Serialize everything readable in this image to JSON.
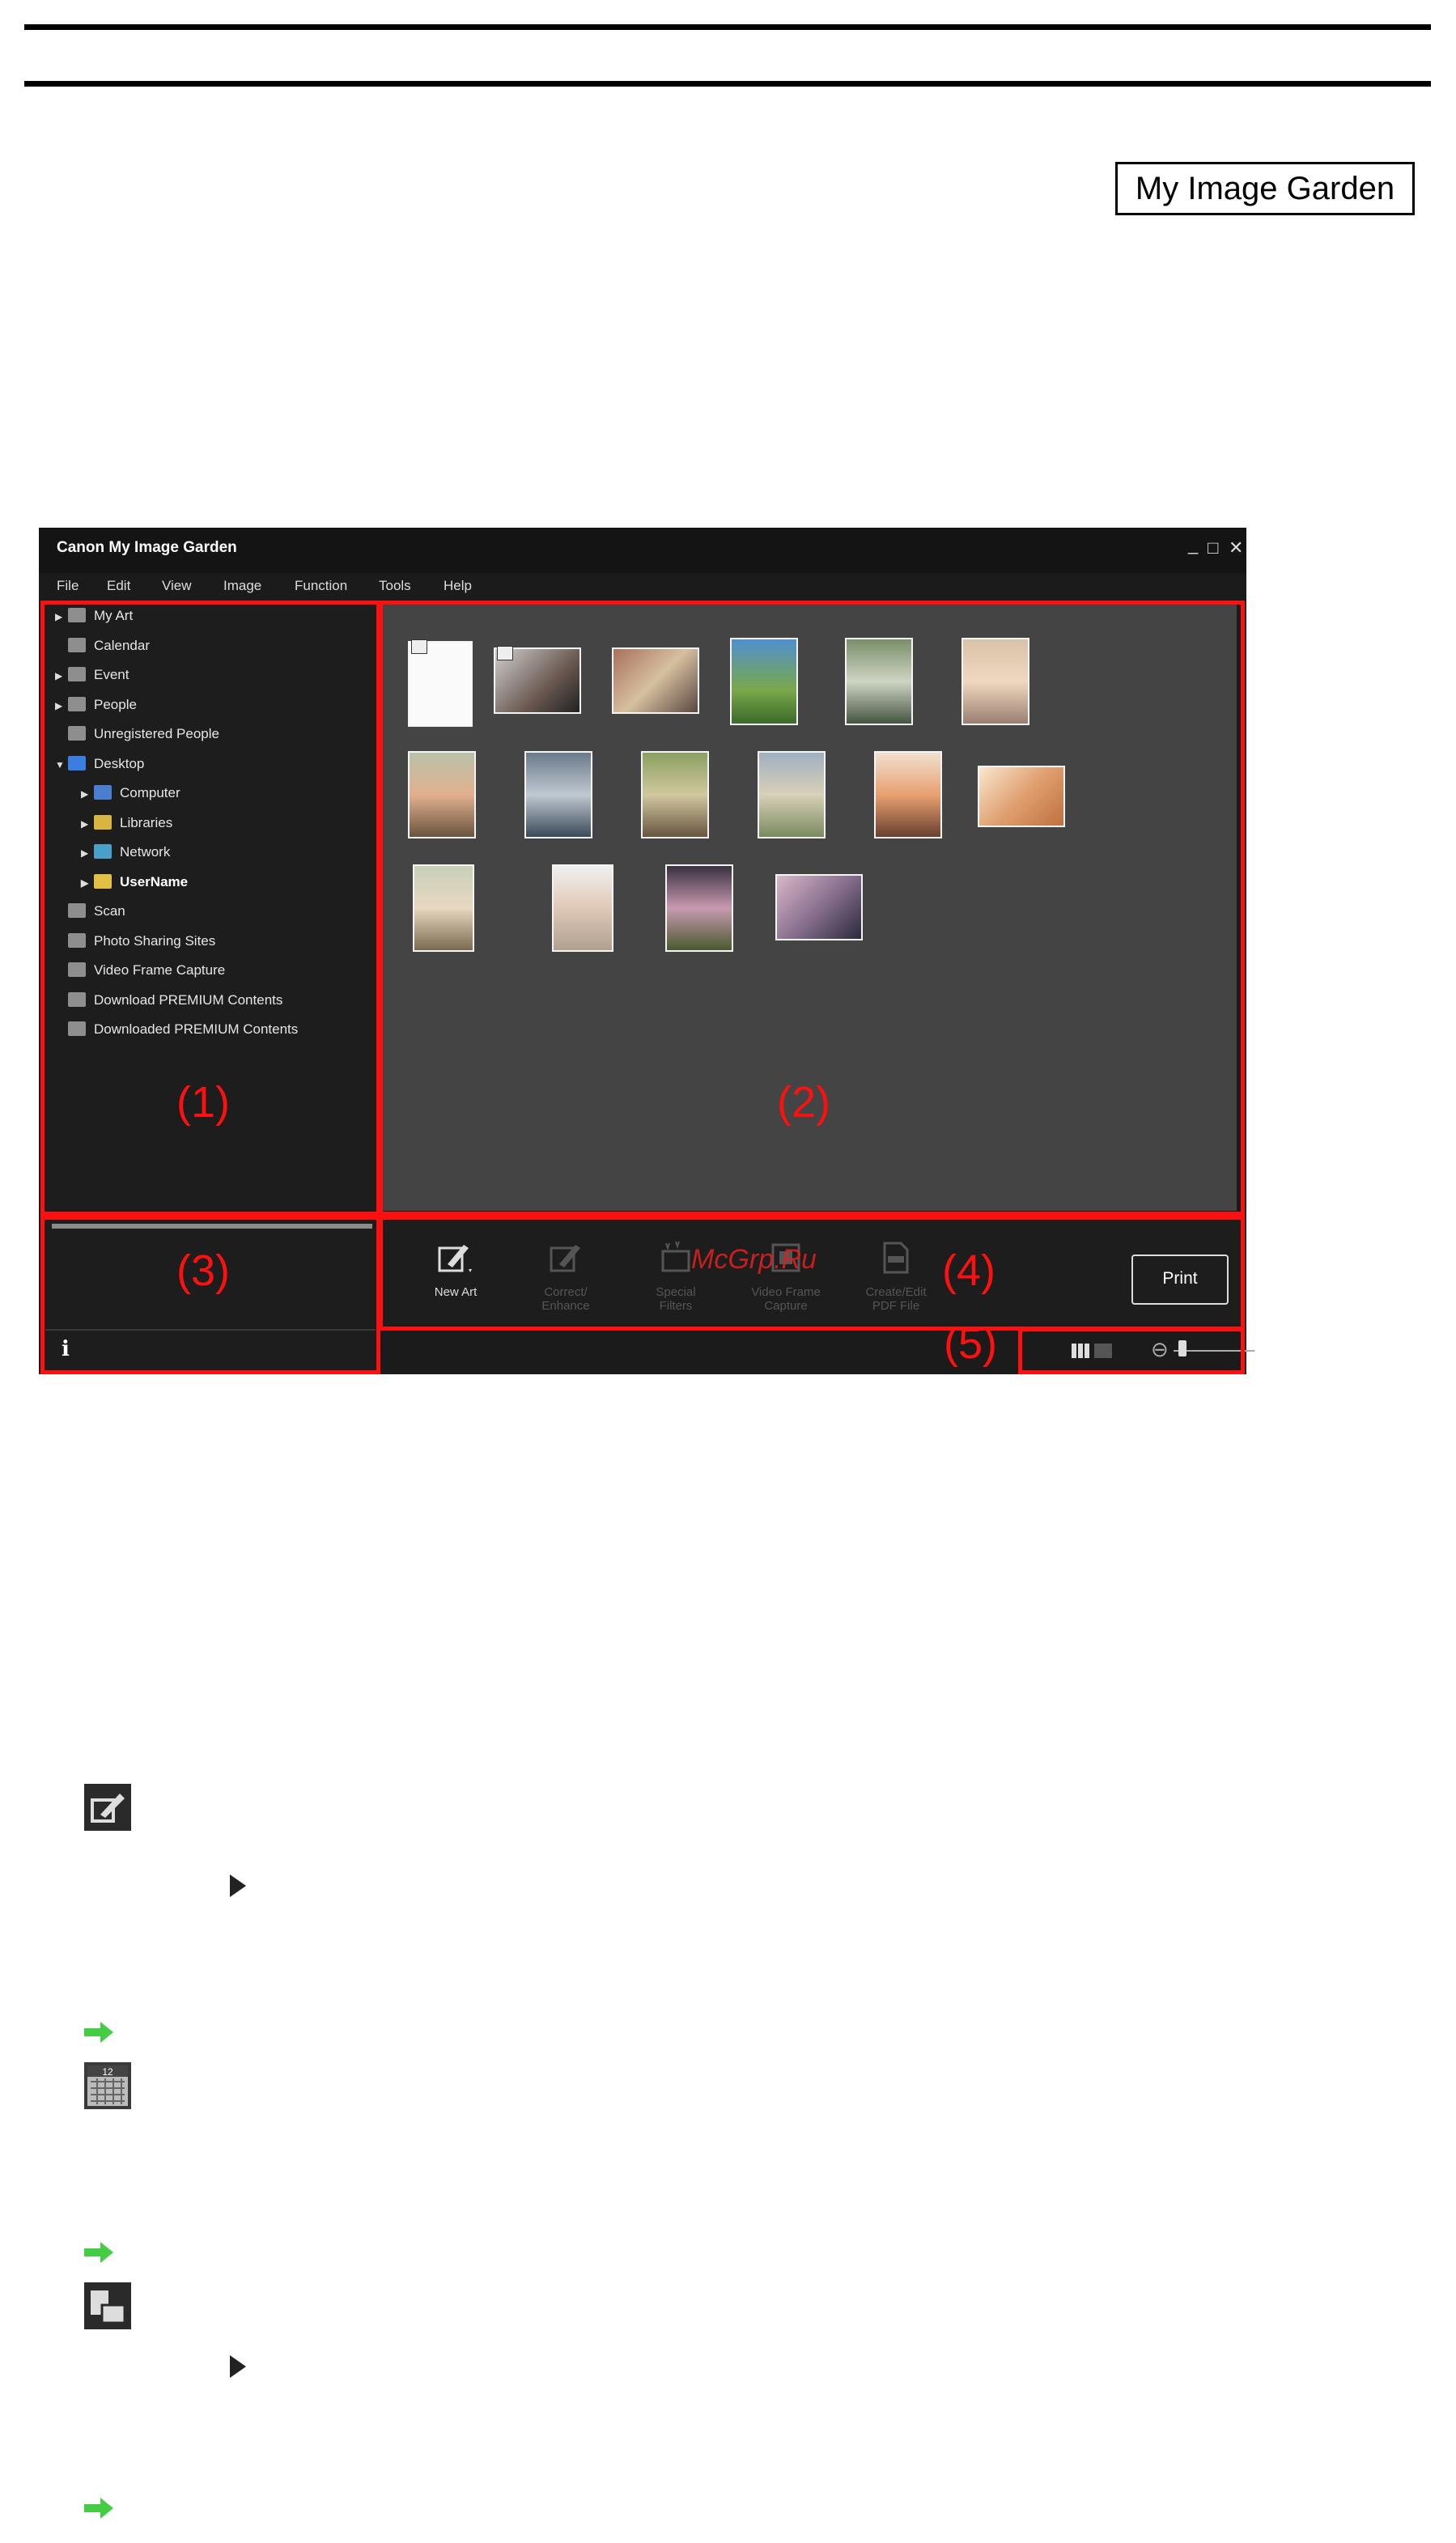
{
  "brand": {
    "label": "My Image Garden"
  },
  "window": {
    "title": "Canon My Image Garden",
    "controls": {
      "minimize": "_",
      "maximize": "□",
      "close": "✕"
    },
    "menu": [
      "File",
      "Edit",
      "View",
      "Image",
      "Function",
      "Tools",
      "Help"
    ]
  },
  "sidebar": {
    "items": [
      {
        "label": "My Art",
        "expandable": true,
        "icon": "my-art-icon"
      },
      {
        "label": "Calendar",
        "expandable": false,
        "icon": "calendar-icon"
      },
      {
        "label": "Event",
        "expandable": true,
        "icon": "event-icon"
      },
      {
        "label": "People",
        "expandable": true,
        "icon": "people-icon"
      },
      {
        "label": "Unregistered People",
        "expandable": false,
        "icon": "unregistered-people-icon"
      },
      {
        "label": "Desktop",
        "expandable": true,
        "expanded": true,
        "icon": "desktop-icon"
      },
      {
        "label": "Computer",
        "expandable": true,
        "icon": "computer-icon"
      },
      {
        "label": "Libraries",
        "expandable": true,
        "icon": "libraries-icon"
      },
      {
        "label": "Network",
        "expandable": true,
        "icon": "network-icon"
      },
      {
        "label": "UserName",
        "expandable": true,
        "bold": true,
        "icon": "user-folder-icon"
      },
      {
        "label": "Scan",
        "expandable": false,
        "icon": "scan-icon"
      },
      {
        "label": "Photo Sharing Sites",
        "expandable": false,
        "icon": "photo-sharing-icon"
      },
      {
        "label": "Video Frame Capture",
        "expandable": false,
        "icon": "video-frame-icon"
      },
      {
        "label": "Download PREMIUM Contents",
        "expandable": false,
        "icon": "download-premium-icon"
      },
      {
        "label": "Downloaded PREMIUM Contents",
        "expandable": false,
        "icon": "downloaded-premium-icon"
      }
    ]
  },
  "toolbar": {
    "tools": [
      {
        "label": "New Art",
        "enabled": true
      },
      {
        "label": "Correct/\nEnhance",
        "enabled": false
      },
      {
        "label": "Special\nFilters",
        "enabled": false
      },
      {
        "label": "Video Frame\nCapture",
        "enabled": false
      },
      {
        "label": "Create/Edit\nPDF File",
        "enabled": false
      }
    ],
    "print": "Print"
  },
  "status": {
    "info": "i",
    "zoom_minus": "⊖",
    "zoom_plus": "⊕"
  },
  "regions": {
    "r1": "(1)",
    "r2": "(2)",
    "r3": "(3)",
    "r4": "(4)",
    "r5": "(5)"
  },
  "watermark": "McGrp.Ru",
  "colors": {
    "highlight": "#ff1010",
    "window_bg": "#1b1b1b",
    "content_bg": "#444444",
    "link_arrow": "#44cc44"
  }
}
